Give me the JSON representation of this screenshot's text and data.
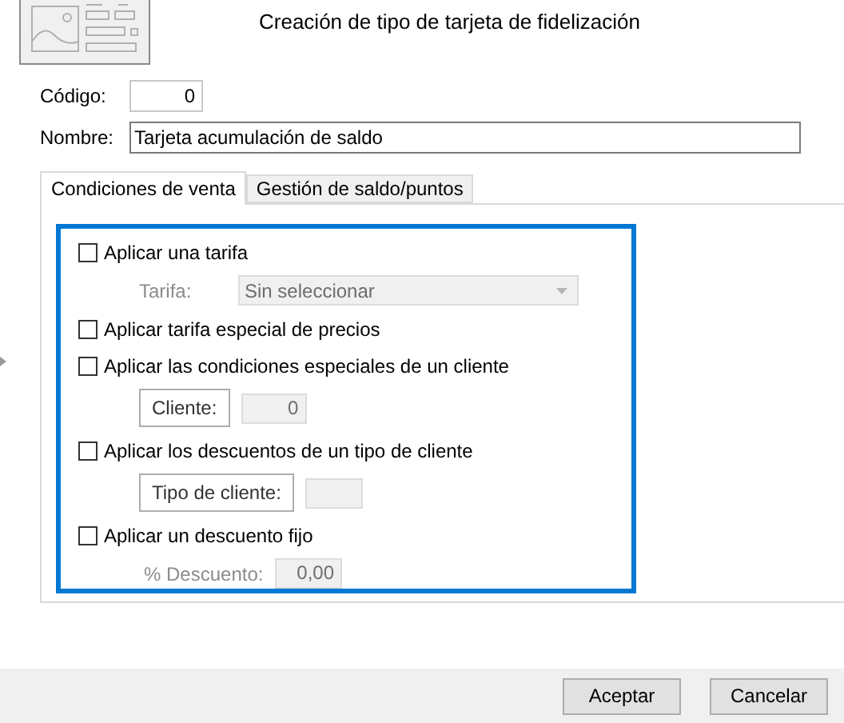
{
  "title": "Creación de tipo de tarjeta de fidelización",
  "fields": [
    {
      "label": "Código:",
      "value": "0",
      "kind": "short"
    },
    {
      "label": "Nombre:",
      "value": "Tarjeta acumulación de saldo",
      "kind": "long"
    }
  ],
  "tabs": [
    {
      "label": "Condiciones de venta",
      "selected": true
    },
    {
      "label": "Gestión de saldo/puntos",
      "selected": false
    }
  ],
  "options": [
    {
      "label": "Aplicar una tarifa",
      "checked": false,
      "sub": {
        "kind": "dropdown",
        "label": "Tarifa:",
        "value": "Sin seleccionar"
      }
    },
    {
      "label": "Aplicar tarifa especial de precios",
      "checked": false
    },
    {
      "label": "Aplicar las condiciones especiales de un cliente",
      "checked": false,
      "sub": {
        "kind": "lookup",
        "label": "Cliente:",
        "value": "0"
      }
    },
    {
      "label": "Aplicar los descuentos de un tipo de cliente",
      "checked": false,
      "sub": {
        "kind": "lookup",
        "label": "Tipo de cliente:"
      }
    },
    {
      "label": "Aplicar un descuento fijo",
      "checked": false,
      "sub": {
        "kind": "number",
        "label": "% Descuento:",
        "value": "0,00"
      }
    }
  ],
  "buttons": [
    "Aceptar",
    "Cancelar"
  ]
}
